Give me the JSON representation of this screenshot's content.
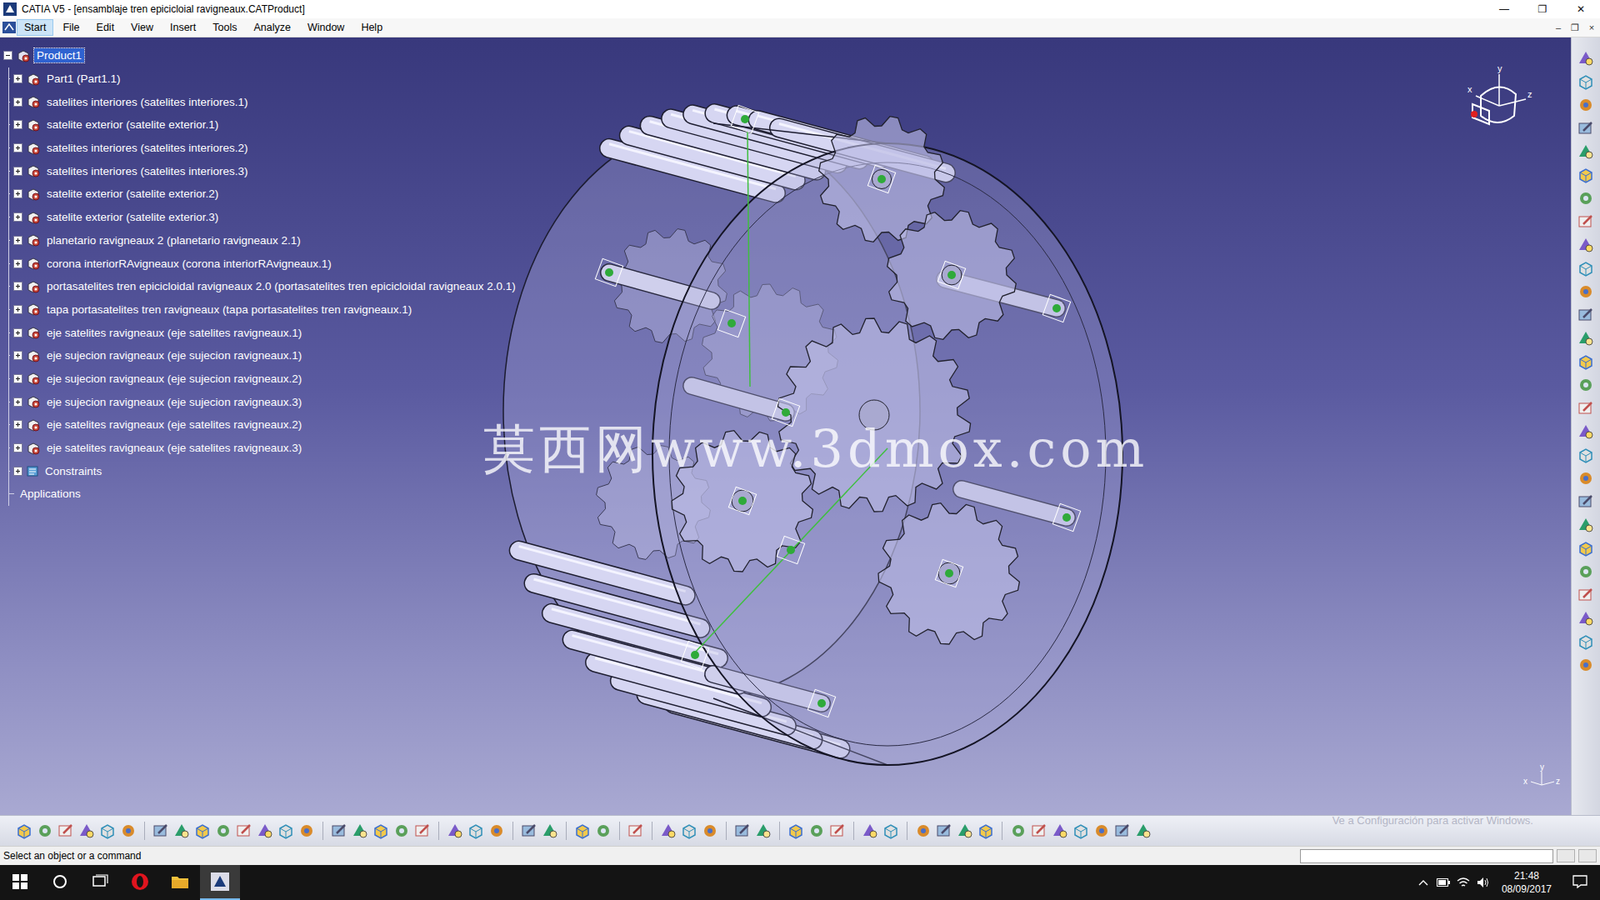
{
  "window": {
    "title": "CATIA V5 - [ensamblaje tren epicicloial ravigneaux.CATProduct]",
    "controls": [
      "—",
      "❐",
      "✕"
    ]
  },
  "menu": [
    {
      "label": "Start",
      "selected": true
    },
    {
      "label": "File",
      "selected": false
    },
    {
      "label": "Edit",
      "selected": false
    },
    {
      "label": "View",
      "selected": false
    },
    {
      "label": "Insert",
      "selected": false
    },
    {
      "label": "Tools",
      "selected": false
    },
    {
      "label": "Analyze",
      "selected": false
    },
    {
      "label": "Window",
      "selected": false
    },
    {
      "label": "Help",
      "selected": false
    }
  ],
  "document_controls": [
    "–",
    "❐",
    "×"
  ],
  "tree": {
    "items": [
      {
        "label": "Product1",
        "kind": "product",
        "selected": true,
        "expanded": true
      },
      {
        "label": "Part1 (Part1.1)",
        "kind": "component",
        "selected": false,
        "expanded": false
      },
      {
        "label": "satelites interiores (satelites interiores.1)",
        "kind": "component",
        "selected": false,
        "expanded": false
      },
      {
        "label": "satelite exterior (satelite exterior.1)",
        "kind": "component",
        "selected": false,
        "expanded": false
      },
      {
        "label": "satelites interiores (satelites interiores.2)",
        "kind": "component",
        "selected": false,
        "expanded": false
      },
      {
        "label": "satelites interiores (satelites interiores.3)",
        "kind": "component",
        "selected": false,
        "expanded": false
      },
      {
        "label": "satelite exterior (satelite exterior.2)",
        "kind": "component",
        "selected": false,
        "expanded": false
      },
      {
        "label": "satelite exterior (satelite exterior.3)",
        "kind": "component",
        "selected": false,
        "expanded": false
      },
      {
        "label": "planetario ravigneaux 2 (planetario ravigneaux 2.1)",
        "kind": "component",
        "selected": false,
        "expanded": false
      },
      {
        "label": "corona interiorRAvigneaux (corona interiorRAvigneaux.1)",
        "kind": "component",
        "selected": false,
        "expanded": false
      },
      {
        "label": "portasatelites tren epicicloidal ravigneaux 2.0 (portasatelites tren epicicloidal ravigneaux 2.0.1)",
        "kind": "component",
        "selected": false,
        "expanded": false
      },
      {
        "label": "tapa portasatelites tren ravigneaux (tapa portasatelites tren ravigneaux.1)",
        "kind": "component",
        "selected": false,
        "expanded": false
      },
      {
        "label": "eje satelites ravigneaux (eje satelites ravigneaux.1)",
        "kind": "component",
        "selected": false,
        "expanded": false
      },
      {
        "label": "eje sujecion ravigneaux (eje sujecion ravigneaux.1)",
        "kind": "component",
        "selected": false,
        "expanded": false
      },
      {
        "label": "eje sujecion ravigneaux (eje sujecion ravigneaux.2)",
        "kind": "component",
        "selected": false,
        "expanded": false
      },
      {
        "label": "eje sujecion ravigneaux (eje sujecion ravigneaux.3)",
        "kind": "component",
        "selected": false,
        "expanded": false
      },
      {
        "label": "eje satelites ravigneaux (eje satelites ravigneaux.2)",
        "kind": "component",
        "selected": false,
        "expanded": false
      },
      {
        "label": "eje satelites ravigneaux (eje satelites ravigneaux.3)",
        "kind": "component",
        "selected": false,
        "expanded": false
      },
      {
        "label": "Constraints",
        "kind": "constraints",
        "selected": false,
        "expanded": false
      },
      {
        "label": "Applications",
        "kind": "applications",
        "selected": false
      }
    ]
  },
  "watermark": "莫西网www.3dmox.com",
  "compass": {
    "labels": [
      "y",
      "x",
      "z"
    ]
  },
  "axis": {
    "labels": [
      "y",
      "x",
      "z"
    ]
  },
  "activation_notice": "Ve a Configuración para activar Windows.",
  "status_bar": {
    "message": "Select an object or a command"
  },
  "taskbar": {
    "time": "21:48",
    "date": "08/09/2017"
  }
}
